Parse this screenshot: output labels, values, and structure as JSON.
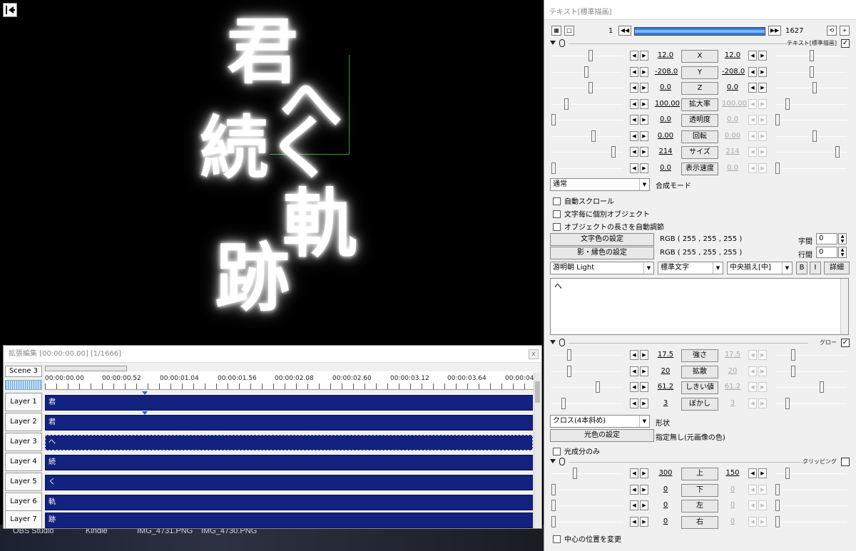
{
  "preview": {
    "glyphs": [
      "君",
      "へ",
      "続",
      "く",
      "軌",
      "跡"
    ]
  },
  "taskbar": {
    "items": [
      "OBS Studio",
      "Kindle",
      "IMG_4731.PNG",
      "IMG_4730.PNG"
    ]
  },
  "timeline": {
    "title": "拡張編集 [00:00:00.00] [1/1666]",
    "close": "x",
    "scene": "Scene 3",
    "ruler": [
      "00:00:00.00",
      "00:00:00.52",
      "00:00:01.04",
      "00:00:01.56",
      "00:00:02.08",
      "00:00:02.60",
      "00:00:03.12",
      "00:00:03.64",
      "00:00:04"
    ],
    "layers": [
      {
        "label": "Layer 1",
        "clip": "君"
      },
      {
        "label": "Layer 2",
        "clip": "君"
      },
      {
        "label": "Layer 3",
        "clip": "へ"
      },
      {
        "label": "Layer 4",
        "clip": "続"
      },
      {
        "label": "Layer 5",
        "clip": "く"
      },
      {
        "label": "Layer 6",
        "clip": "軌"
      },
      {
        "label": "Layer 7",
        "clip": "跡"
      }
    ]
  },
  "panel": {
    "title": "テキスト[標準描画]",
    "frame_start": "1",
    "frame_end": "1627",
    "text_section": "テキスト[標準描画]",
    "params": [
      {
        "left": "12.0",
        "label": "X",
        "right": "12.0",
        "right_dim": false
      },
      {
        "left": "-208.0",
        "label": "Y",
        "right": "-208.0",
        "right_dim": false
      },
      {
        "left": "0.0",
        "label": "Z",
        "right": "0.0",
        "right_dim": false
      },
      {
        "left": "100.00",
        "label": "拡大率",
        "right": "100.00",
        "right_dim": true
      },
      {
        "left": "0.0",
        "label": "透明度",
        "right": "0.0",
        "right_dim": true
      },
      {
        "left": "0.00",
        "label": "回転",
        "right": "0.00",
        "right_dim": true
      },
      {
        "left": "214",
        "label": "サイズ",
        "right": "214",
        "right_dim": true
      },
      {
        "left": "0.0",
        "label": "表示速度",
        "right": "0.0",
        "right_dim": true
      }
    ],
    "blend_mode": "通常",
    "blend_label": "合成モード",
    "checks": [
      "自動スクロール",
      "文字毎に個別オブジェクト",
      "オブジェクトの長さを自動調節"
    ],
    "text_color_btn": "文字色の設定",
    "text_color_val": "RGB ( 255 , 255 , 255 )",
    "shadow_color_btn": "影・縁色の設定",
    "shadow_color_val": "RGB ( 255 , 255 , 255 )",
    "char_spacing_label": "字間",
    "char_spacing": "0",
    "line_spacing_label": "行間",
    "line_spacing": "0",
    "font": "游明朝 Light",
    "style": "標準文字",
    "align": "中央揃え[中]",
    "bold": "B",
    "italic": "I",
    "detail": "詳細",
    "text_content": "へ",
    "glow_section": "グロー",
    "glow_params": [
      {
        "left": "17.5",
        "label": "強さ",
        "right": "17.5",
        "right_dim": true
      },
      {
        "left": "20",
        "label": "拡散",
        "right": "20",
        "right_dim": true
      },
      {
        "left": "61.2",
        "label": "しきい値",
        "right": "61.2",
        "right_dim": true
      },
      {
        "left": "3",
        "label": "ぼかし",
        "right": "3",
        "right_dim": true
      }
    ],
    "shape": "クロス(4本斜め)",
    "shape_label": "形状",
    "light_color_btn": "光色の設定",
    "light_color_val": "指定無し(元画像の色)",
    "light_only": "光成分のみ",
    "clip_section": "クリッピング",
    "clip_params": [
      {
        "left": "300",
        "label": "上",
        "right": "150",
        "right_dim": false
      },
      {
        "left": "0",
        "label": "下",
        "right": "0",
        "right_dim": true
      },
      {
        "left": "0",
        "label": "左",
        "right": "0",
        "right_dim": true
      },
      {
        "left": "0",
        "label": "右",
        "right": "0",
        "right_dim": true
      }
    ],
    "center_change": "中心の位置を変更"
  },
  "colors": {
    "clip_blue": "#13227f",
    "seek_blue": "#2f7fe2",
    "glow_green": "#3a9b3a"
  },
  "icons": [
    "back-to-start-icon",
    "prev-frame-icon",
    "next-frame-icon",
    "section-collapse-icon",
    "mouse-icon"
  ]
}
